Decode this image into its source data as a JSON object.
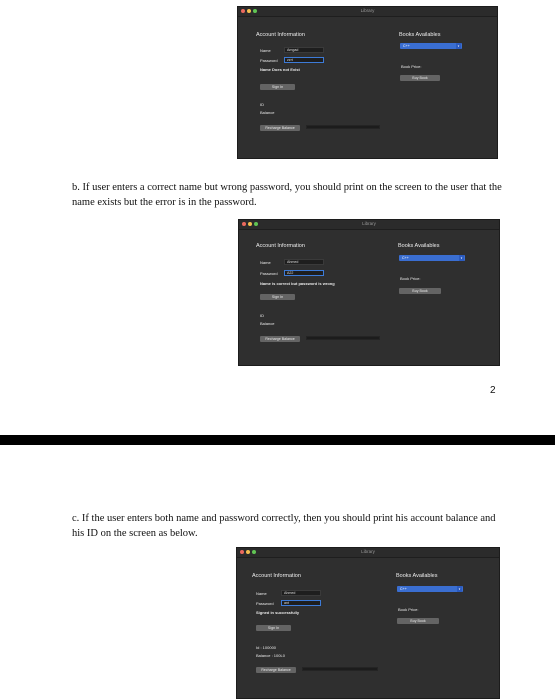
{
  "page_number": "2",
  "captions": {
    "b": "b.  If user enters a correct name but wrong password, you should print on the screen to the user that the name exists but the error is in the password.",
    "c": "c.  If the user enters both name and password correctly, then you should print his account balance and his ID on the screen as below."
  },
  "windows": [
    {
      "title": "Library",
      "account_header": "Account Information",
      "name_label": "Name",
      "name_value": "Amgad",
      "password_label": "Password",
      "password_value": "zzrt",
      "message": "Name Does not Exist",
      "signin_label": "Sign In",
      "id_label": "ID",
      "balance_label": "Balance",
      "recharge_label": "Recharge Balance",
      "books_header": "Books Availables",
      "book_selected": "C++",
      "book_price_label": "Book Price:",
      "buy_label": "Buy Book"
    },
    {
      "title": "Library",
      "account_header": "Account Information",
      "name_label": "Name",
      "name_value": "Ahmed",
      "password_label": "Password",
      "password_value": "A22",
      "message": "Name is correct but password is wrong",
      "signin_label": "Sign In",
      "id_label": "ID",
      "balance_label": "Balance",
      "recharge_label": "Recharge Balance",
      "books_header": "Books Availables",
      "book_selected": "C++",
      "book_price_label": "Book Price:",
      "buy_label": "Buy Book"
    },
    {
      "title": "Library",
      "account_header": "Account Information",
      "name_label": "Name",
      "name_value": "Ahmed",
      "password_label": "Password",
      "password_value": "ant",
      "message": "Signed in successfully",
      "signin_label": "Sign In",
      "id_label": "Id : 100000",
      "balance_label": "Balance : 100L0",
      "recharge_label": "Recharge Balance",
      "books_header": "Books Availables",
      "book_selected": "C++",
      "book_price_label": "Book Price:",
      "buy_label": "Buy Book"
    }
  ],
  "colors": {
    "window_bg": "#2f2f2f",
    "select_accent": "#3a6ed1",
    "focus_border": "#3d7bd8",
    "button_bg": "#646464"
  }
}
